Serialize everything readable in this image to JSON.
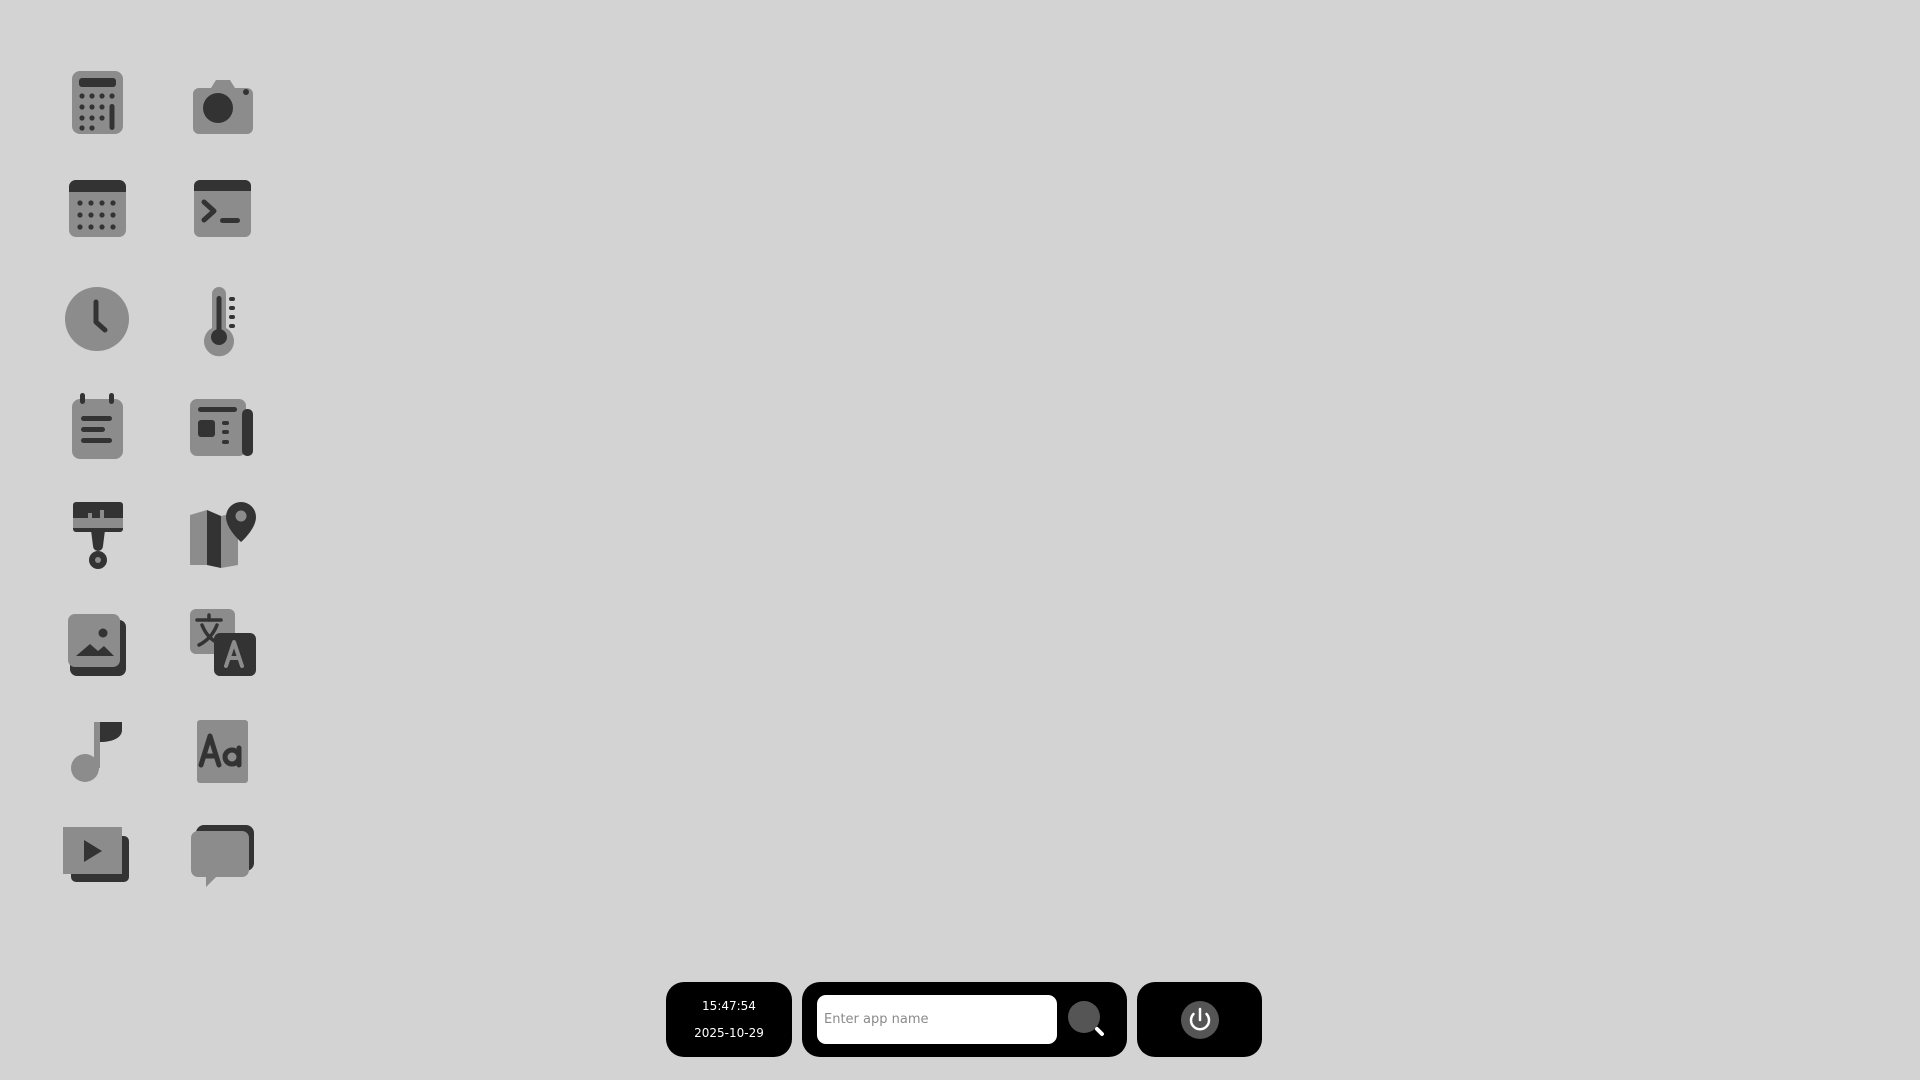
{
  "desktop": {
    "apps": [
      {
        "icon": "calculator-icon"
      },
      {
        "icon": "camera-icon"
      },
      {
        "icon": "calendar-icon"
      },
      {
        "icon": "terminal-icon"
      },
      {
        "icon": "clock-icon"
      },
      {
        "icon": "thermometer-icon"
      },
      {
        "icon": "notes-icon"
      },
      {
        "icon": "news-icon"
      },
      {
        "icon": "paint-brush-icon"
      },
      {
        "icon": "map-icon"
      },
      {
        "icon": "photos-icon"
      },
      {
        "icon": "translate-icon"
      },
      {
        "icon": "music-icon"
      },
      {
        "icon": "font-icon"
      },
      {
        "icon": "video-player-icon"
      },
      {
        "icon": "chat-icon"
      }
    ]
  },
  "taskbar": {
    "time": "15:47:54",
    "date": "2025-10-29",
    "search_placeholder": "Enter app name",
    "search_value": "",
    "search_icon": "search-icon",
    "power_icon": "power-icon"
  },
  "colors": {
    "background": "#d3d3d3",
    "icon_light": "#8c8c8c",
    "icon_dark": "#333333",
    "panel": "#000000"
  }
}
